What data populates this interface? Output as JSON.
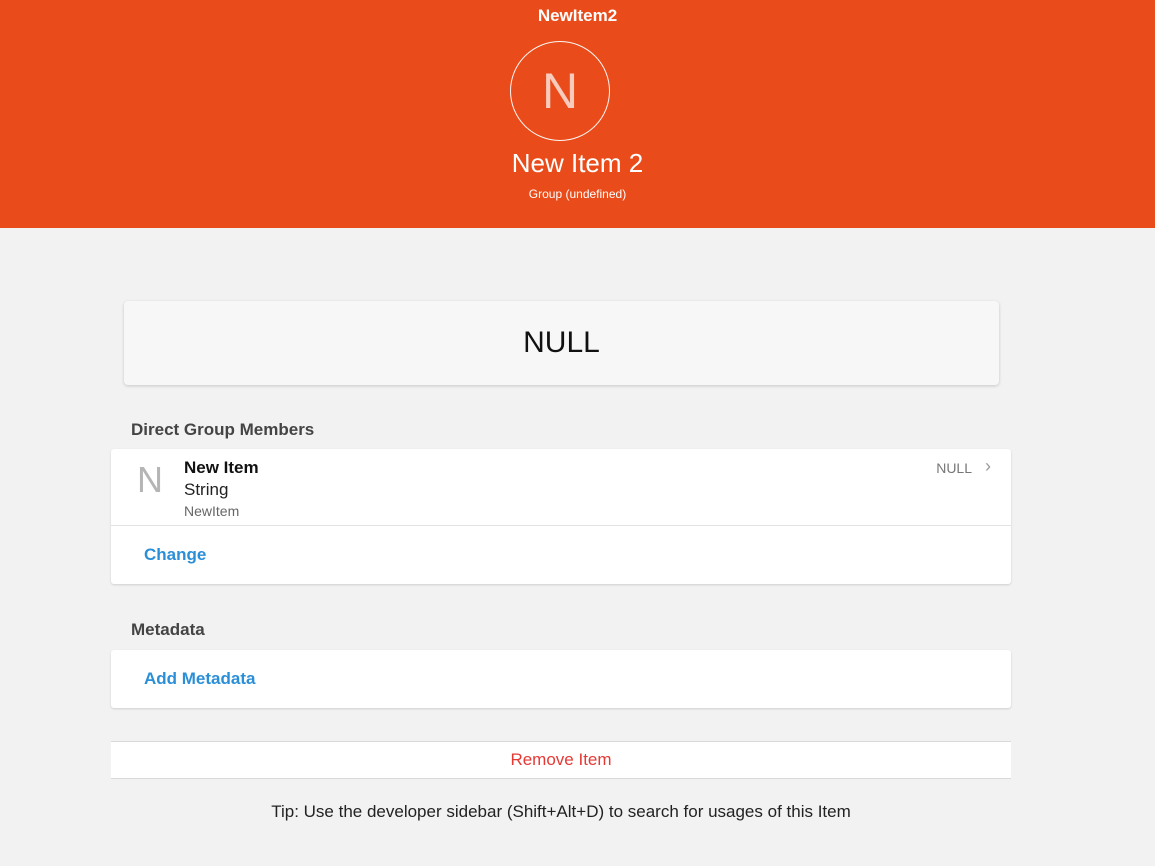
{
  "header": {
    "item_name": "NewItem2",
    "avatar_letter": "N",
    "item_label": "New Item 2",
    "item_type": "Group (undefined)",
    "background_color": "#e94c1a"
  },
  "state": {
    "value": "NULL"
  },
  "members": {
    "title": "Direct Group Members",
    "items": [
      {
        "icon_letter": "N",
        "label": "New Item",
        "type": "String",
        "name": "NewItem",
        "state": "NULL",
        "chevron": "›"
      }
    ],
    "change_label": "Change"
  },
  "metadata": {
    "title": "Metadata",
    "add_label": "Add Metadata"
  },
  "actions": {
    "remove_label": "Remove Item"
  },
  "tip": {
    "text": "Tip: Use the developer sidebar (Shift+Alt+D) to search for usages of this Item"
  },
  "colors": {
    "accent_link": "#2b8fd8",
    "danger": "#e53935"
  }
}
